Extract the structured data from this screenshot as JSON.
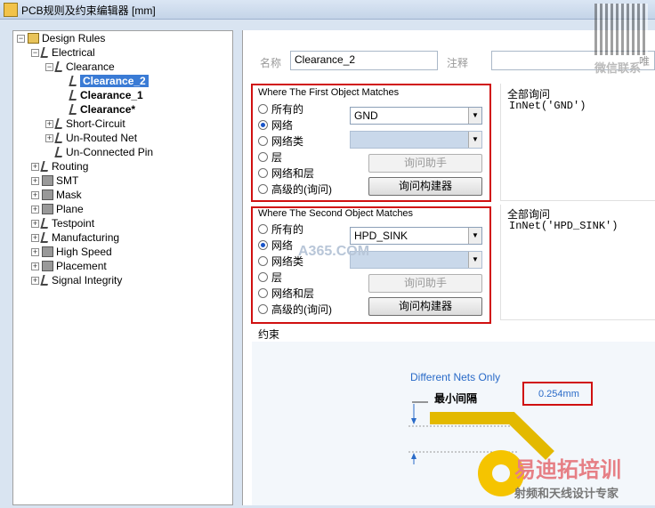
{
  "window": {
    "title": "PCB规则及约束编辑器 [mm]"
  },
  "tree": {
    "root": "Design Rules",
    "electrical": "Electrical",
    "clearance": "Clearance",
    "clearance_items": [
      "Clearance_2",
      "Clearance_1",
      "Clearance*"
    ],
    "electrical_children": [
      "Short-Circuit",
      "Un-Routed Net",
      "Un-Connected Pin"
    ],
    "categories": [
      "Routing",
      "SMT",
      "Mask",
      "Plane",
      "Testpoint",
      "Manufacturing",
      "High Speed",
      "Placement",
      "Signal Integrity"
    ]
  },
  "header": {
    "name_label": "名称",
    "name_value": "Clearance_2",
    "comment_label": "注释",
    "comment_value": "",
    "right_label": "唯"
  },
  "first": {
    "title": "Where The First Object Matches",
    "options": [
      "所有的",
      "网络",
      "网络类",
      "层",
      "网络和层",
      "高级的(询问)"
    ],
    "selected": 1,
    "net_value": "GND",
    "helper_btn": "询问助手",
    "builder_btn": "询问构建器",
    "query_title": "全部询问",
    "query_text": "InNet('GND')"
  },
  "second": {
    "title": "Where The Second Object Matches",
    "options": [
      "所有的",
      "网络",
      "网络类",
      "层",
      "网络和层",
      "高级的(询问)"
    ],
    "selected": 1,
    "net_value": "HPD_SINK",
    "helper_btn": "询问助手",
    "builder_btn": "询问构建器",
    "query_title": "全部询问",
    "query_text": "InNet('HPD_SINK')"
  },
  "constraint": {
    "title": "约束",
    "diff_nets": "Different Nets Only",
    "min_clearance_label": "最小间隔",
    "min_clearance_value": "0.254mm"
  },
  "watermarks": {
    "site": "A365.COM",
    "wechat": "微信联系",
    "brand": "易迪拓培训",
    "brand_sub": "射频和天线设计专家"
  },
  "colors": {
    "highlight_red": "#d01010",
    "selection_blue": "#3a7bd5",
    "link_blue": "#2a6bc8"
  }
}
